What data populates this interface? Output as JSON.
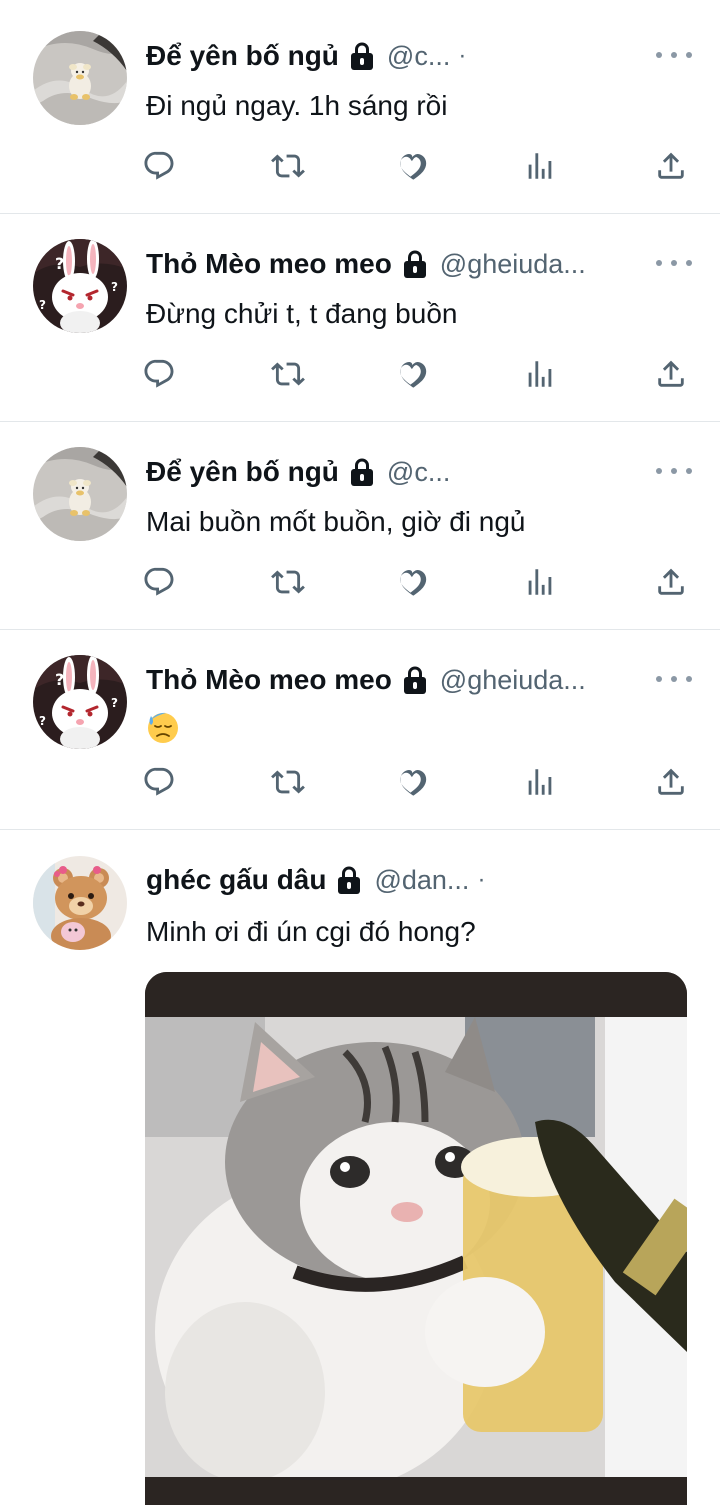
{
  "tweets": [
    {
      "name": "Để yên bố ngủ",
      "handle": "@c...",
      "extra": "·",
      "text": "Đi ngủ ngay. 1h sáng rồi",
      "avatar": "sheep-plush-avatar"
    },
    {
      "name": "Thỏ Mèo meo meo",
      "handle": "@gheiuda...",
      "text": "Đừng chửi t, t đang buồn",
      "avatar": "white-rabbit-avatar"
    },
    {
      "name": "Để yên bố ngủ",
      "handle": "@c...",
      "text": "Mai buồn mốt buồn, giờ đi ngủ",
      "avatar": "sheep-plush-avatar"
    },
    {
      "name": "Thỏ Mèo meo meo",
      "handle": "@gheiuda...",
      "text": "",
      "emoji": "downcast-sweat-face",
      "avatar": "white-rabbit-avatar"
    },
    {
      "name": "ghéc gấu dâu",
      "handle": "@dan...",
      "extra": "·",
      "text": "Minh ơi đi ún cgi đó hong?",
      "avatar": "teddy-bear-avatar",
      "media": "crying-cat-with-beer-image"
    }
  ],
  "icons": {
    "reply": "reply-icon",
    "retweet": "retweet-icon",
    "like": "like-icon",
    "views": "views-icon",
    "share": "share-icon",
    "more": "more-options-icon",
    "lock": "lock-icon"
  },
  "colors": {
    "text": "#0f1419",
    "secondary": "#536471",
    "divider": "#e3e7ea"
  }
}
